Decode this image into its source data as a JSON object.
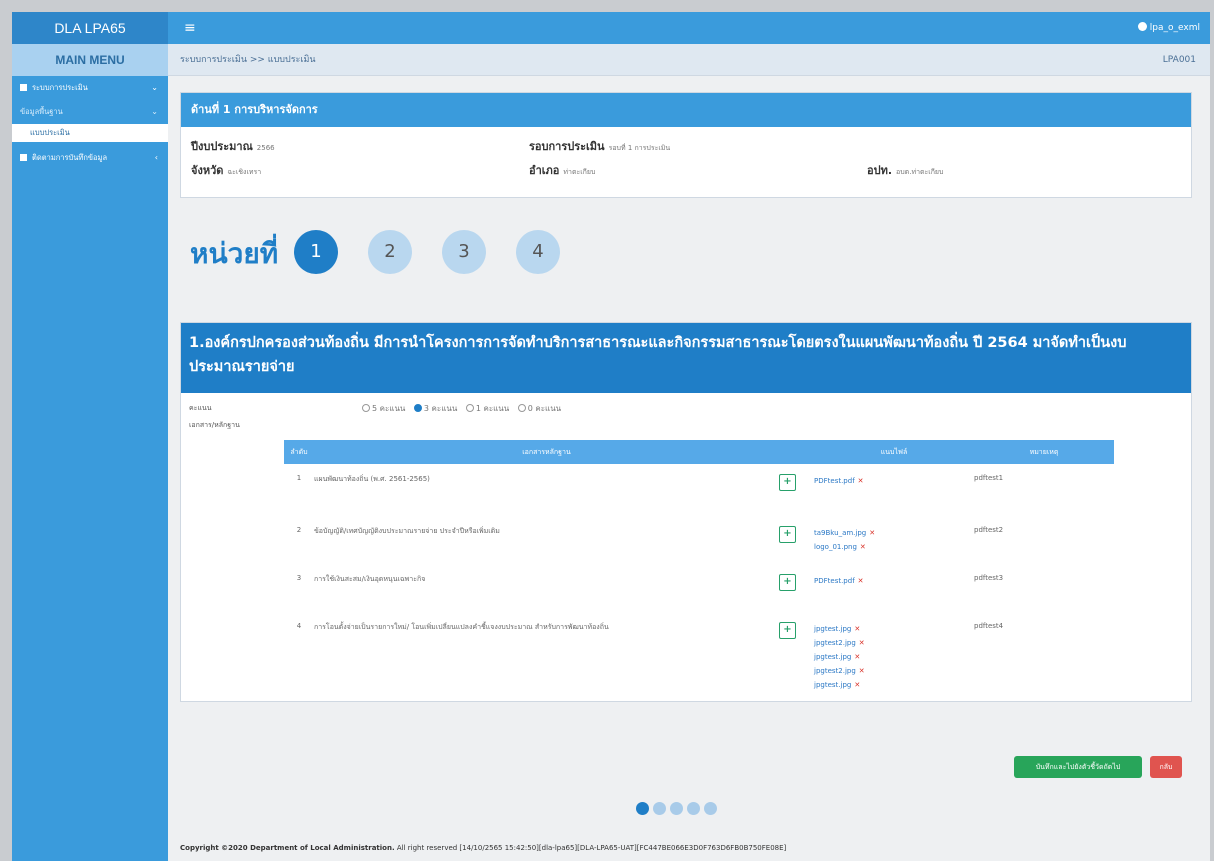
{
  "app": {
    "brand": "DLA LPA65",
    "menu_icon": "≡",
    "user": "lpa_o_exml"
  },
  "sidebar": {
    "title": "MAIN MENU",
    "items": [
      {
        "label": "ระบบการประเมิน",
        "arrow": "⌄"
      },
      {
        "label": "ข้อมูลพื้นฐาน",
        "arrow": "⌄"
      },
      {
        "label": "ติดตามการบันทึกข้อมูล",
        "arrow": "‹"
      }
    ],
    "sub_item": "แบบประเมิน"
  },
  "breadcrumb": {
    "path": "ระบบการประเมิน >> แบบประเมิน",
    "code": "LPA001"
  },
  "info_card": {
    "title": "ด้านที่ 1 การบริหารจัดการ",
    "fiscal_year_label": "ปีงบประมาณ",
    "fiscal_year": "2566",
    "round_label": "รอบการประเมิน",
    "round": "รอบที่ 1 การประเมิน",
    "province_label": "จังหวัด",
    "province": "ฉะเชิงเทรา",
    "district_label": "อำเภอ",
    "district": "ท่าตะเกียบ",
    "org_label": "อปท.",
    "org": "อบต.ท่าตะเกียบ"
  },
  "units": {
    "label": "หน่วยที่",
    "items": [
      "1",
      "2",
      "3",
      "4"
    ],
    "active": 0
  },
  "question": {
    "title": "1.องค์กรปกครองส่วนท้องถิ่น มีการนำโครงการการจัดทำบริการสาธารณะและกิจกรรมสาธารณะโดยตรงในแผนพัฒนาท้องถิ่น ปี 2564 มาจัดทำเป็นงบประมาณรายจ่าย",
    "score_label": "คะแนน",
    "score_options": [
      "5 คะแนน",
      "3 คะแนน",
      "1 คะแนน",
      "0 คะแนน"
    ],
    "score_selected": 1,
    "docs_label": "เอกสาร/หลักฐาน",
    "table": {
      "headers": [
        "ลำดับ",
        "เอกสารหลักฐาน",
        "",
        "แนบไฟล์",
        "หมายเหตุ"
      ],
      "rows": [
        {
          "no": "1",
          "doc": "แผนพัฒนาท้องถิ่น (พ.ศ. 2561-2565)",
          "files": [
            "PDFtest.pdf"
          ],
          "note": "pdftest1"
        },
        {
          "no": "2",
          "doc": "ข้อบัญญัติ/เทศบัญญัติงบประมาณรายจ่าย ประจำปีหรือเพิ่มเติม",
          "files": [
            "ta9Bku_am.jpg",
            "logo_01.png"
          ],
          "note": "pdftest2"
        },
        {
          "no": "3",
          "doc": "การใช้เงินสะสม/เงินอุดหนุนเฉพาะกิจ",
          "files": [
            "PDFtest.pdf"
          ],
          "note": "pdftest3"
        },
        {
          "no": "4",
          "doc": "การโอนตั้งจ่ายเป็นรายการใหม่/ โอนเพิ่มเปลี่ยนแปลงคำชี้แจงงบประมาณ สำหรับการพัฒนาท้องถิ่น",
          "files": [
            "jpgtest.jpg",
            "jpgtest2.jpg",
            "jpgtest.jpg",
            "jpgtest2.jpg",
            "jpgtest.jpg"
          ],
          "note": "pdftest4"
        }
      ]
    }
  },
  "buttons": {
    "save": "บันทึกและไปยังตัวชี้วัดถัดไป",
    "back": "กลับ"
  },
  "pager": {
    "count": 5,
    "active": 0
  },
  "footer": {
    "copyright": "Copyright ©2020 Department of Local Administration.",
    "rest": "All right reserved [14/10/2565 15:42:50][dla-lpa65][DLA-LPA65-UAT][FC447BE066E3D0F763D6FB0B750FE08E]"
  }
}
